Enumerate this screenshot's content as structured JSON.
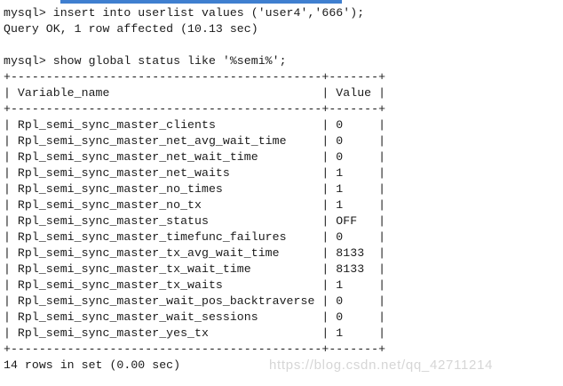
{
  "terminal": {
    "insert_command": "mysql> insert into userlist values ('user4','666');",
    "insert_result": "Query OK, 1 row affected (10.13 sec)",
    "show_command": "mysql> show global status like '%semi%';",
    "table": {
      "border": "+--------------------------------------------+-------+",
      "header": "| Variable_name                              | Value |",
      "rows": [
        "| Rpl_semi_sync_master_clients               | 0     |",
        "| Rpl_semi_sync_master_net_avg_wait_time     | 0     |",
        "| Rpl_semi_sync_master_net_wait_time         | 0     |",
        "| Rpl_semi_sync_master_net_waits             | 1     |",
        "| Rpl_semi_sync_master_no_times              | 1     |",
        "| Rpl_semi_sync_master_no_tx                 | 1     |",
        "| Rpl_semi_sync_master_status                | OFF   |",
        "| Rpl_semi_sync_master_timefunc_failures     | 0     |",
        "| Rpl_semi_sync_master_tx_avg_wait_time      | 8133  |",
        "| Rpl_semi_sync_master_tx_wait_time          | 8133  |",
        "| Rpl_semi_sync_master_tx_waits              | 1     |",
        "| Rpl_semi_sync_master_wait_pos_backtraverse | 0     |",
        "| Rpl_semi_sync_master_wait_sessions         | 0     |",
        "| Rpl_semi_sync_master_yes_tx                | 1     |"
      ]
    },
    "summary": "14 rows in set (0.00 sec)"
  },
  "watermark": "https://blog.csdn.net/qq_42711214",
  "colors": {
    "background": "#ffffff",
    "text": "#1a1a1a",
    "top_bar": "#3f7fd0",
    "watermark": "#d6d6d6"
  }
}
